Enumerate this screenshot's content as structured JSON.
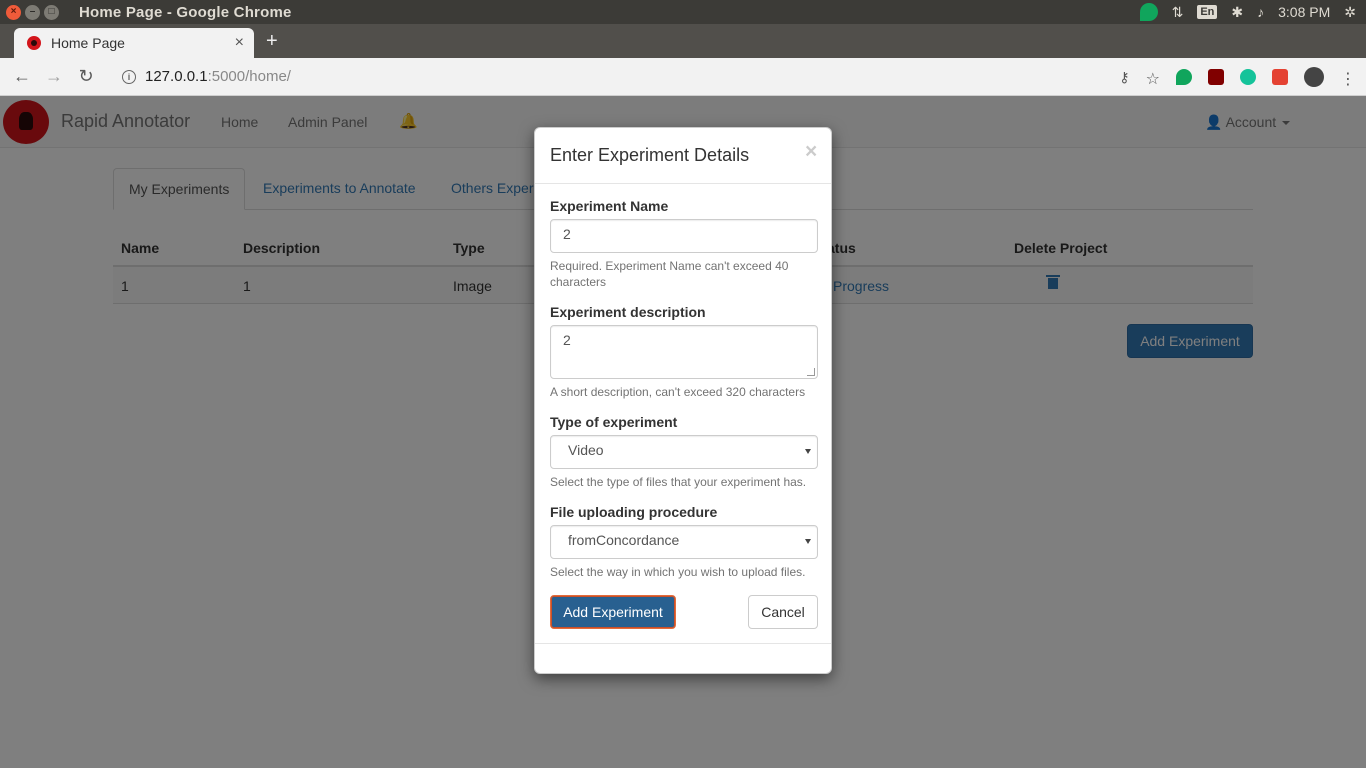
{
  "os": {
    "window_title": "Home Page - Google Chrome",
    "lang": "En",
    "clock": "3:08 PM"
  },
  "browser": {
    "tab_title": "Home Page",
    "tab_close": "×",
    "new_tab": "+",
    "url_host": "127.0.0.1",
    "url_rest": ":5000/home/"
  },
  "navbar": {
    "brand": "Rapid Annotator",
    "links": [
      "Home",
      "Admin Panel"
    ],
    "account": "Account"
  },
  "tabs": [
    "My Experiments",
    "Experiments to Annotate",
    "Others Exper"
  ],
  "table": {
    "headers": [
      "Name",
      "Description",
      "Type",
      "atus",
      "Delete Project"
    ],
    "row": {
      "name": "1",
      "description": "1",
      "type": "Image",
      "status": "Progress"
    }
  },
  "add_experiment_button": "Add Experiment",
  "modal": {
    "title": "Enter Experiment Details",
    "close": "×",
    "name_label": "Experiment Name",
    "name_value": "2",
    "name_help": "Required. Experiment Name can't exceed 40 characters",
    "desc_label": "Experiment description",
    "desc_value": "2",
    "desc_help": "A short description, can't exceed 320 characters",
    "type_label": "Type of experiment",
    "type_value": "Video",
    "type_help": "Select the type of files that your experiment has.",
    "upload_label": "File uploading procedure",
    "upload_value": "fromConcordance",
    "upload_help": "Select the way in which you wish to upload files.",
    "submit": "Add Experiment",
    "cancel": "Cancel"
  },
  "colors": {
    "primary": "#337ab7",
    "primary_dark": "#286090",
    "os_bar": "#3c3b37",
    "logo_red": "#d3151b"
  }
}
